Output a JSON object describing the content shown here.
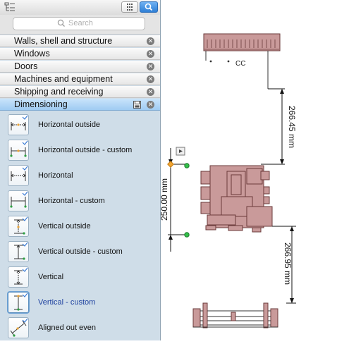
{
  "search": {
    "placeholder": "Search"
  },
  "categories": [
    {
      "label": "Walls, shell and structure"
    },
    {
      "label": "Windows"
    },
    {
      "label": "Doors"
    },
    {
      "label": "Machines and equipment"
    },
    {
      "label": "Shipping and receiving"
    },
    {
      "label": "Dimensioning",
      "active": true
    }
  ],
  "items": [
    {
      "label": "Horizontal outside",
      "icon": "horizontal-outside-icon"
    },
    {
      "label": "Horizontal outside - custom",
      "icon": "horizontal-outside-custom-icon"
    },
    {
      "label": "Horizontal",
      "icon": "horizontal-dimension-icon"
    },
    {
      "label": "Horizontal - custom",
      "icon": "horizontal-custom-icon"
    },
    {
      "label": "Vertical outside",
      "icon": "vertical-outside-icon"
    },
    {
      "label": "Vertical outside - custom",
      "icon": "vertical-outside-custom-icon"
    },
    {
      "label": "Vertical",
      "icon": "vertical-dimension-icon"
    },
    {
      "label": "Vertical - custom",
      "icon": "vertical-custom-icon",
      "selected": true
    },
    {
      "label": "Aligned out even",
      "icon": "aligned-out-even-icon"
    }
  ],
  "canvas": {
    "equipment_label": "CC",
    "dim_top": "266.45 mm",
    "dim_left": "250.00 mm",
    "dim_bottom": "266.95 mm"
  },
  "colors": {
    "equipment_fill": "#c99a9a",
    "equipment_stroke": "#6a3a3a",
    "active_category": "#a8d0f5",
    "panel_bg": "#cfdde8"
  }
}
